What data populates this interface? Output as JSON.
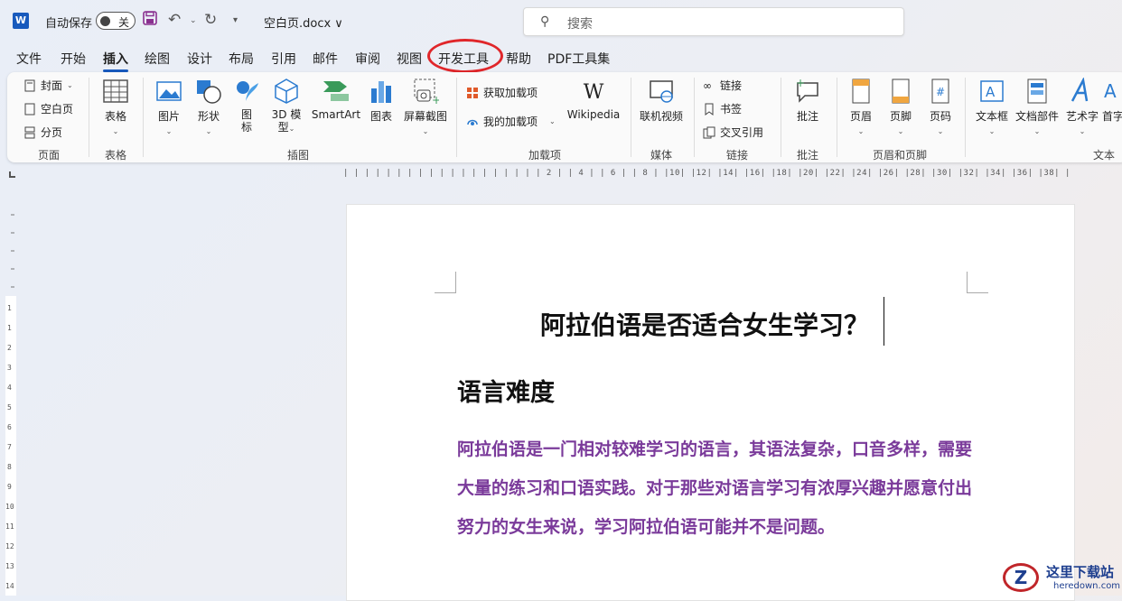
{
  "titlebar": {
    "app_logo": "W",
    "autosave_label": "自动保存",
    "autosave_state": "关",
    "filename": "空白页.docx ∨",
    "search_placeholder": "搜索"
  },
  "tabs": [
    "文件",
    "开始",
    "插入",
    "绘图",
    "设计",
    "布局",
    "引用",
    "邮件",
    "审阅",
    "视图",
    "开发工具",
    "帮助",
    "PDF工具集"
  ],
  "active_tab": "插入",
  "highlighted_tab": "开发工具",
  "ribbon": {
    "pages": {
      "cover": "封面",
      "blank": "空白页",
      "break": "分页",
      "group": "页面"
    },
    "table": {
      "table": "表格",
      "group": "表格"
    },
    "illustrations": {
      "picture": "图片",
      "shapes": "形状",
      "icons_1": "图",
      "icons_2": "标",
      "model3d_1": "3D 模",
      "model3d_2": "型",
      "smartart": "SmartArt",
      "chart": "图表",
      "screenshot": "屏幕截图",
      "group": "插图"
    },
    "addins": {
      "get": "获取加载项",
      "my": "我的加载项",
      "wikipedia": "Wikipedia",
      "group": "加载项"
    },
    "media": {
      "video": "联机视频",
      "group": "媒体"
    },
    "links": {
      "link": "链接",
      "bookmark": "书签",
      "crossref": "交叉引用",
      "group": "链接"
    },
    "comments": {
      "comment": "批注",
      "group": "批注"
    },
    "headerfooter": {
      "header": "页眉",
      "footer": "页脚",
      "pagenum": "页码",
      "group": "页眉和页脚"
    },
    "text": {
      "textbox": "文本框",
      "quickparts": "文档部件",
      "wordart": "艺术字",
      "dropcap": "首字",
      "group": "文本"
    }
  },
  "ruler_text": "|  |  |  |  |  |  |  |  |  |  |  |  |  |  |  |  |  |  | 2 |  | 4 |  | 6 |  | 8 |  |10|  |12|  |14|  |16|  |18|  |20|  |22|  |24|  |26|  |28|  |30|  |32|  |34|  |36|  |38|  |  |  |  |  |  |  |",
  "document": {
    "title": "阿拉伯语是否适合女生学习？",
    "heading": "语言难度",
    "paragraph": "阿拉伯语是一门相对较难学习的语言，其语法复杂，口音多样，需要大量的练习和口语实践。对于那些对语言学习有浓厚兴趣并愿意付出努力的女生来说，学习阿拉伯语可能并不是问题。"
  },
  "watermark": {
    "name": "这里下载站",
    "url": "heredown.com"
  },
  "colors": {
    "accent": "#185abd",
    "highlight_circle": "#e0262a",
    "paragraph": "#7a3a9a"
  }
}
